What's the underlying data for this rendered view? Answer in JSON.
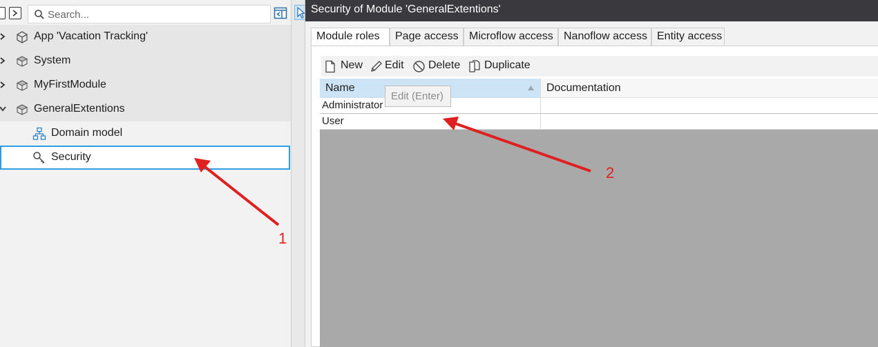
{
  "explorer": {
    "search": {
      "placeholder": "Search...",
      "value": ""
    },
    "items": [
      {
        "label": "App 'Vacation Tracking'",
        "expander": "chevron-right",
        "icon": "package-icon"
      },
      {
        "label": "System",
        "expander": "chevron-right",
        "icon": "module-icon"
      },
      {
        "label": "MyFirstModule",
        "expander": "chevron-right",
        "icon": "module-icon"
      },
      {
        "label": "GeneralExtentions",
        "expander": "chevron-down",
        "icon": "module-icon"
      },
      {
        "label": "Domain model",
        "icon": "domain-model-icon"
      },
      {
        "label": "Security",
        "icon": "key-icon",
        "selected": true
      }
    ]
  },
  "document": {
    "title": "Security of Module 'GeneralExtentions'",
    "tabs": [
      "Module roles",
      "Page access",
      "Microflow access",
      "Nanoflow access",
      "Entity access"
    ],
    "active_tab": "Module roles",
    "toolbar": {
      "new_label": "New",
      "edit_label": "Edit",
      "delete_label": "Delete",
      "duplicate_label": "Duplicate"
    },
    "grid": {
      "columns": [
        "Name",
        "Documentation"
      ],
      "sorted_column": "Name",
      "rows": [
        {
          "name": "Administrator",
          "documentation": ""
        },
        {
          "name": "User",
          "documentation": ""
        }
      ]
    },
    "tooltip": "Edit (Enter)"
  },
  "annotations": [
    {
      "label": "1",
      "color": "#e02020"
    },
    {
      "label": "2",
      "color": "#e02020"
    }
  ],
  "colors": {
    "selection_border": "#2b9de0",
    "title_bar": "#3a3a3e",
    "sorted_header": "#cde4f7",
    "annotation": "#e02020"
  }
}
